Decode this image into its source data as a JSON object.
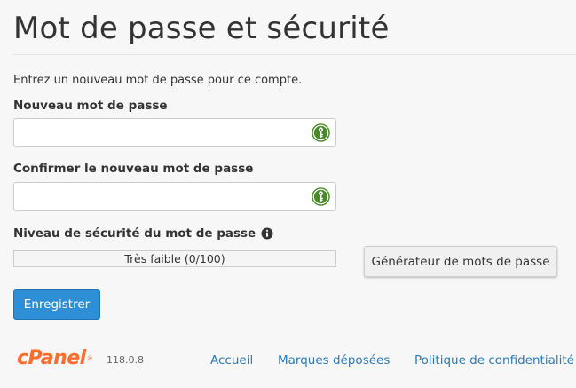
{
  "page": {
    "title": "Mot de passe et sécurité",
    "intro": "Entrez un nouveau mot de passe pour ce compte."
  },
  "form": {
    "new_password": {
      "label": "Nouveau mot de passe",
      "value": "",
      "placeholder": "",
      "icon": "key-icon"
    },
    "confirm_password": {
      "label": "Confirmer le nouveau mot de passe",
      "value": "",
      "placeholder": "",
      "icon": "key-icon"
    },
    "strength": {
      "label": "Niveau de sécurité du mot de passe",
      "info_icon": "info-icon",
      "text": "Très faible (0/100)",
      "score": 0,
      "max": 100
    },
    "generator_button": "Générateur de mots de passe",
    "save_button": "Enregistrer"
  },
  "footer": {
    "logo": "cPanel",
    "version": "118.0.8",
    "links": [
      "Accueil",
      "Marques déposées",
      "Politique de confidentialité"
    ]
  },
  "colors": {
    "accent": "#2f8fd6",
    "link": "#2a7ab8",
    "logo": "#ff6c2c",
    "key_icon": "#4a8a2a",
    "strength_fill": "#d9534f"
  }
}
